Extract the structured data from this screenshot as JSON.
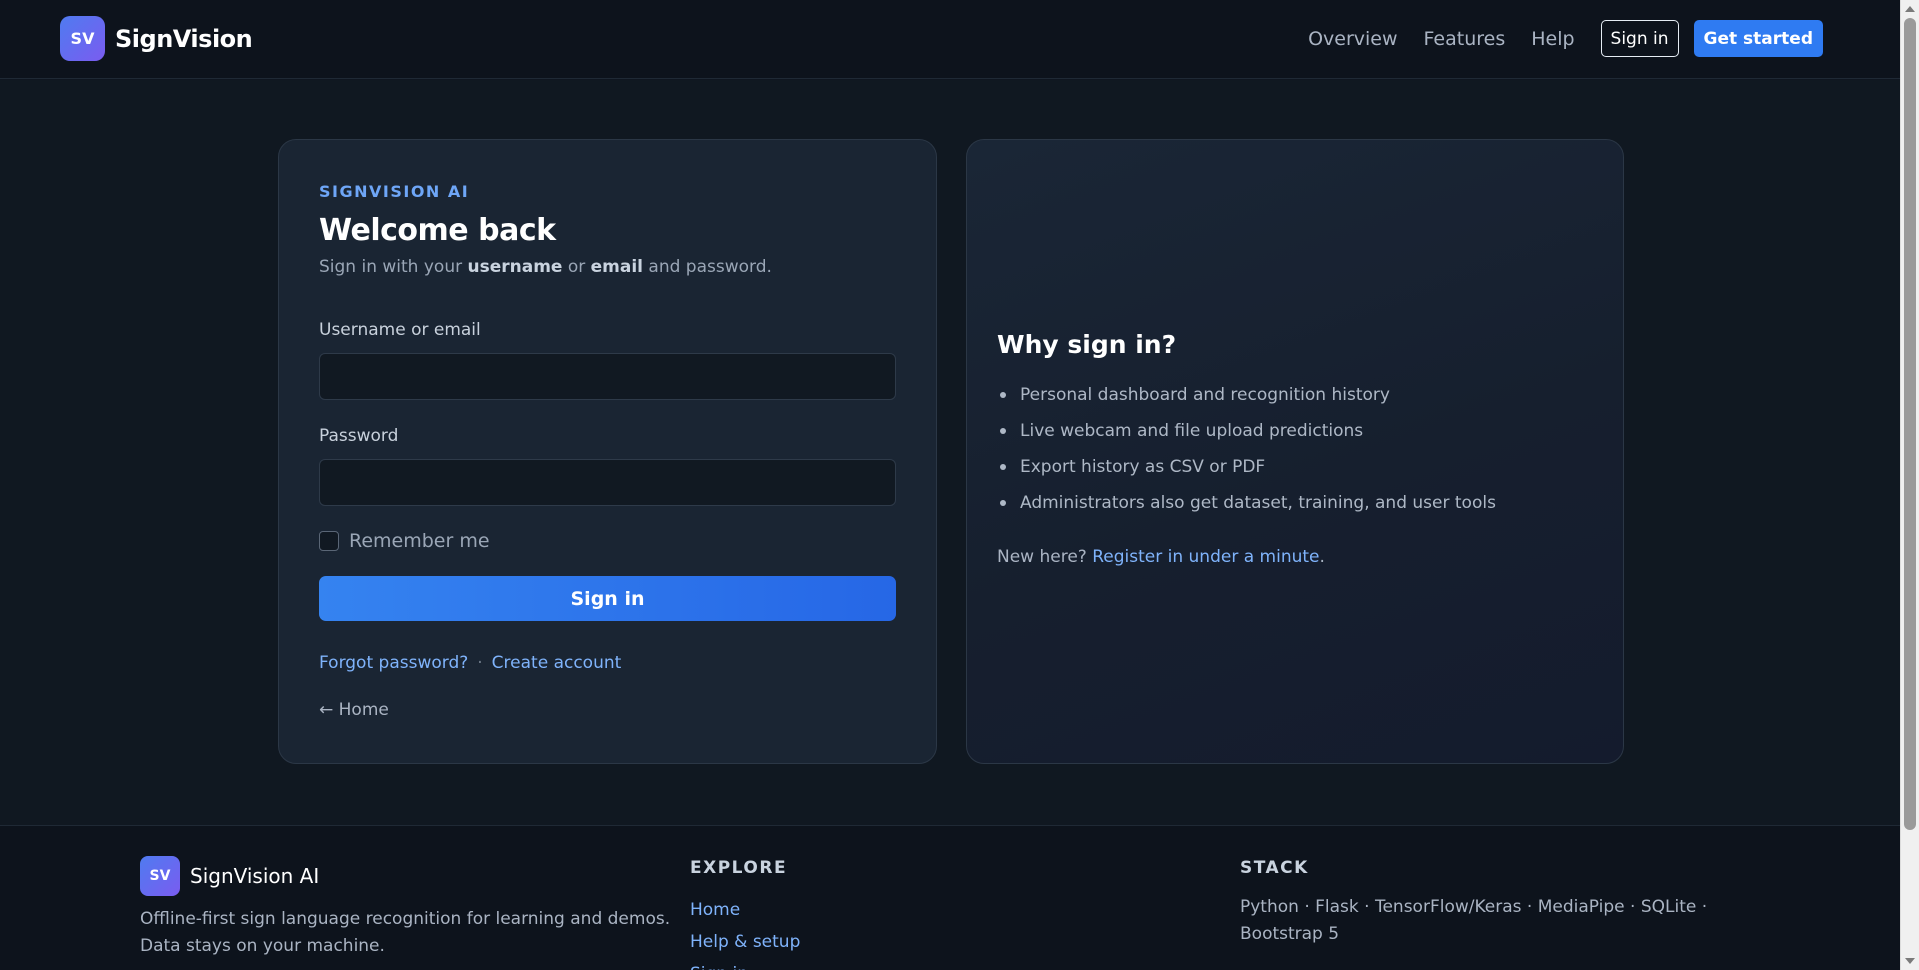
{
  "navbar": {
    "logo_text": "SV",
    "brand": "SignVision",
    "links": [
      "Overview",
      "Features",
      "Help"
    ],
    "signin_label": "Sign in",
    "get_started_label": "Get started"
  },
  "login": {
    "eyebrow": "SIGNVISION AI",
    "title": "Welcome back",
    "subtitle_pre": "Sign in with your ",
    "subtitle_bold1": "username",
    "subtitle_mid": " or ",
    "subtitle_bold2": "email",
    "subtitle_post": " and password.",
    "username_label": "Username or email",
    "username_value": "",
    "password_label": "Password",
    "password_value": "",
    "remember_label": "Remember me",
    "remember_checked": false,
    "submit_label": "Sign in",
    "forgot_label": "Forgot password?",
    "separator": "·",
    "create_label": "Create account",
    "home_label": "← Home"
  },
  "info": {
    "title": "Why sign in?",
    "items": [
      "Personal dashboard and recognition history",
      "Live webcam and file upload predictions",
      "Export history as CSV or PDF",
      "Administrators also get dataset, training, and user tools"
    ],
    "new_here": "New here?",
    "register_label": "Register in under a minute",
    "register_suffix": "."
  },
  "footer": {
    "logo_text": "SV",
    "brand": "SignVision AI",
    "description": "Offline-first sign language recognition for learning and demos. Data stays on your machine.",
    "explore_heading": "EXPLORE",
    "explore_links": [
      "Home",
      "Help & setup",
      "Sign in"
    ],
    "stack_heading": "STACK",
    "stack_text": "Python · Flask · TensorFlow/Keras · MediaPipe · SQLite · Bootstrap 5"
  },
  "colors": {
    "accent": "#2f7bf2",
    "link": "#7fb3fb",
    "eyebrow": "#6ea6f7",
    "background": "#101821"
  }
}
